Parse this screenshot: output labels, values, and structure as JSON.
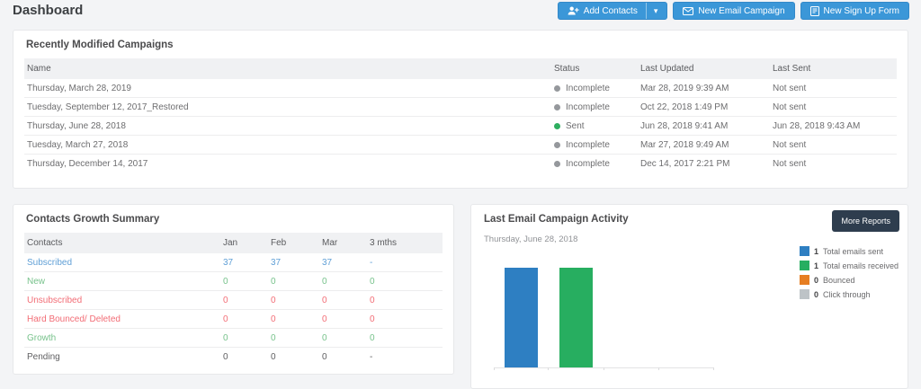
{
  "page": {
    "title": "Dashboard"
  },
  "header": {
    "buttons": {
      "add_contacts": "Add Contacts",
      "new_email_campaign": "New Email Campaign",
      "new_sign_up_form": "New Sign Up Form"
    }
  },
  "icons": {
    "caret_down": "▾"
  },
  "colors": {
    "accent_blue": "#3b97d8",
    "dark_button": "#2e3d4e",
    "incomplete_dot": "#95989c",
    "sent_dot": "#2eae60"
  },
  "campaigns": {
    "title": "Recently Modified Campaigns",
    "columns": [
      "Name",
      "Status",
      "Last Updated",
      "Last Sent"
    ],
    "rows": [
      {
        "name": "Thursday, March 28, 2019",
        "status": "Incomplete",
        "dot": "#95989c",
        "updated": "Mar 28, 2019 9:39 AM",
        "sent": "Not sent"
      },
      {
        "name": "Tuesday, September 12, 2017_Restored",
        "status": "Incomplete",
        "dot": "#95989c",
        "updated": "Oct 22, 2018 1:49 PM",
        "sent": "Not sent"
      },
      {
        "name": "Thursday, June 28, 2018",
        "status": "Sent",
        "dot": "#2eae60",
        "updated": "Jun 28, 2018 9:41 AM",
        "sent": "Jun 28, 2018 9:43 AM"
      },
      {
        "name": "Tuesday, March 27, 2018",
        "status": "Incomplete",
        "dot": "#95989c",
        "updated": "Mar 27, 2018 9:49 AM",
        "sent": "Not sent"
      },
      {
        "name": "Thursday, December 14, 2017",
        "status": "Incomplete",
        "dot": "#95989c",
        "updated": "Dec 14, 2017 2:21 PM",
        "sent": "Not sent"
      }
    ]
  },
  "growth": {
    "title": "Contacts Growth Summary",
    "columns": [
      "Contacts",
      "Jan",
      "Feb",
      "Mar",
      "3 mths"
    ],
    "rows": [
      {
        "label": "Subscribed",
        "color": "#5f9fd6",
        "values": [
          "37",
          "37",
          "37",
          "-"
        ]
      },
      {
        "label": "New",
        "color": "#77c28b",
        "values": [
          "0",
          "0",
          "0",
          "0"
        ]
      },
      {
        "label": "Unsubscribed",
        "color": "#f26d76",
        "values": [
          "0",
          "0",
          "0",
          "0"
        ]
      },
      {
        "label": "Hard Bounced/ Deleted",
        "color": "#f26d76",
        "values": [
          "0",
          "0",
          "0",
          "0"
        ]
      },
      {
        "label": "Growth",
        "color": "#77c28b",
        "values": [
          "0",
          "0",
          "0",
          "0"
        ]
      },
      {
        "label": "Pending",
        "color": "#5f5f61",
        "values": [
          "0",
          "0",
          "0",
          "-"
        ]
      }
    ]
  },
  "activity": {
    "title": "Last Email Campaign Activity",
    "more_reports_label": "More Reports",
    "subtitle": "Thursday, June 28, 2018",
    "chart_data": {
      "type": "bar",
      "categories": [
        "Total emails sent",
        "Total emails received",
        "Bounced",
        "Click through"
      ],
      "values": [
        1,
        1,
        0,
        0
      ],
      "colors": [
        "#2e7fc2",
        "#27ae60",
        "#e67e22",
        "#bdc3c7"
      ],
      "ylim": [
        0,
        1
      ],
      "grid": false,
      "legend_position": "right",
      "legend": [
        {
          "value": "1",
          "label": "Total emails sent",
          "color": "#2e7fc2"
        },
        {
          "value": "1",
          "label": "Total emails received",
          "color": "#27ae60"
        },
        {
          "value": "0",
          "label": "Bounced",
          "color": "#e67e22"
        },
        {
          "value": "0",
          "label": "Click through",
          "color": "#bdc3c7"
        }
      ]
    }
  }
}
